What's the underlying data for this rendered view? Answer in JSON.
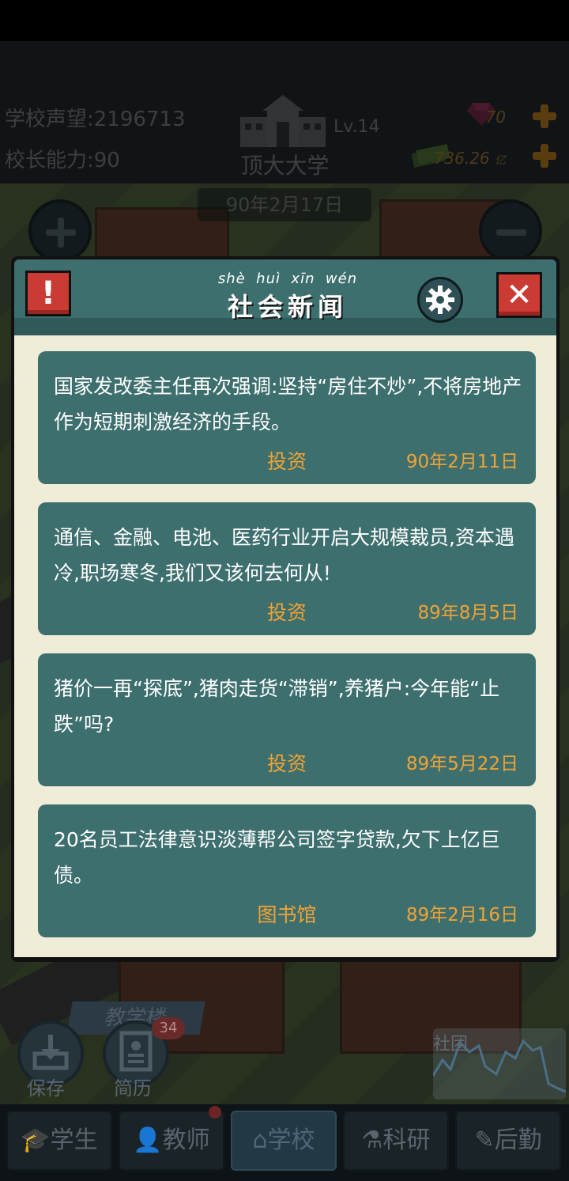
{
  "header": {
    "reputation_label": "学校声望:",
    "reputation_value": "2196713",
    "ability_label": "校长能力:",
    "ability_value": "90",
    "school_name": "顶大大学",
    "level": "Lv.14",
    "gems": "70",
    "money": "736.26",
    "money_unit": "亿",
    "date": "90年2月17日"
  },
  "modal": {
    "title_pinyin": "shè  huì  xīn  wén",
    "title": "社会新闻",
    "alert_icon": "!",
    "close_icon": "✕",
    "news": [
      {
        "text": "国家发改委主任再次强调:坚持“房住不炒”,不将房地产作为短期刺激经济的手段。",
        "category": "投资",
        "date": "90年2月11日"
      },
      {
        "text": "通信、金融、电池、医药行业开启大规模裁员,资本遇冷,职场寒冬,我们又该何去何从!",
        "category": "投资",
        "date": "89年8月5日"
      },
      {
        "text": "猪价一再“探底”,猪肉走货“滞销”,养猪户:今年能“止跌”吗?",
        "category": "投资",
        "date": "89年5月22日"
      },
      {
        "text": "20名员工法律意识淡薄帮公司签字贷款,欠下上亿巨债。",
        "category": "图书馆",
        "date": "89年2月16日"
      }
    ]
  },
  "scene": {
    "building_label": "教学楼",
    "save_label": "保存",
    "resume_label": "简历",
    "resume_badge": "34",
    "club_label": "社团"
  },
  "nav": {
    "tabs": [
      "学生",
      "教师",
      "学校",
      "科研",
      "后勤"
    ]
  },
  "colors": {
    "panel": "#3e6f6f",
    "accent": "#f0a334",
    "close_red": "#c93b33",
    "modal_bg": "#efecd8"
  }
}
